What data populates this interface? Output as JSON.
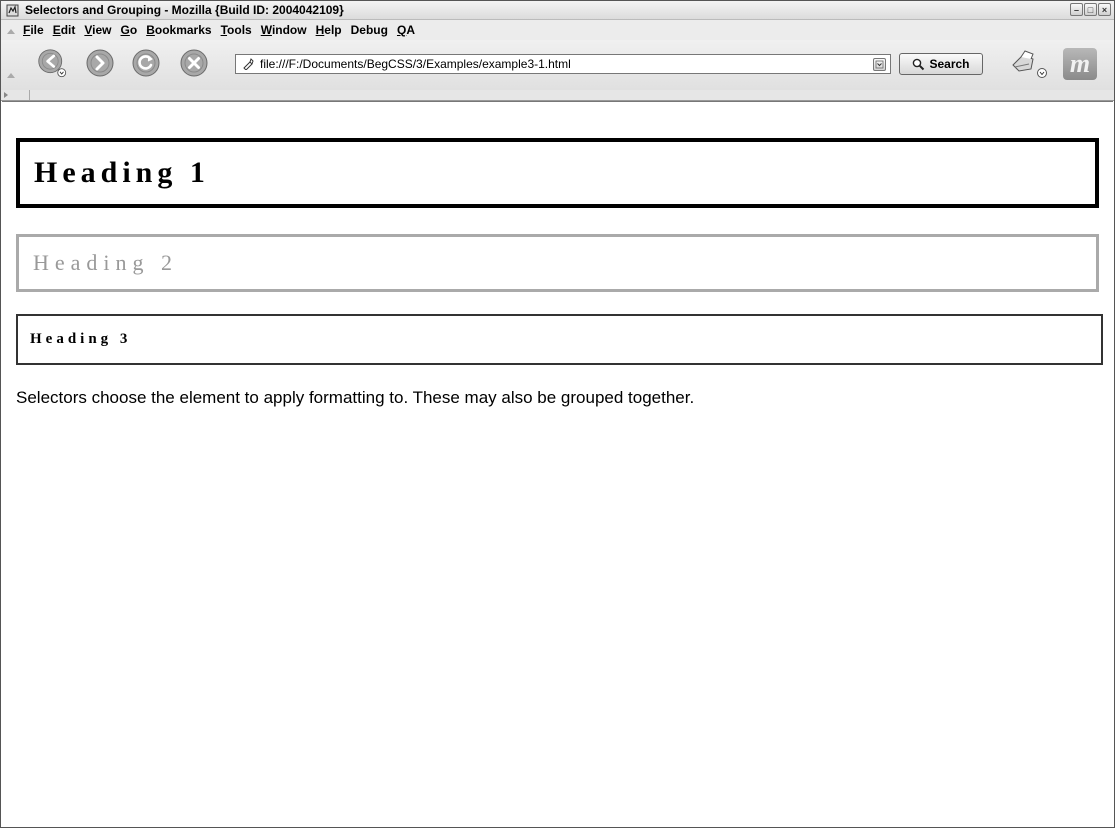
{
  "window": {
    "title": "Selectors and Grouping - Mozilla {Build ID: 2004042109}",
    "controls": [
      "minimize",
      "maximize",
      "close"
    ]
  },
  "menubar": {
    "items": [
      {
        "label": "File",
        "accel": "F"
      },
      {
        "label": "Edit",
        "accel": "E"
      },
      {
        "label": "View",
        "accel": "V"
      },
      {
        "label": "Go",
        "accel": "G"
      },
      {
        "label": "Bookmarks",
        "accel": "B"
      },
      {
        "label": "Tools",
        "accel": "T"
      },
      {
        "label": "Window",
        "accel": "W"
      },
      {
        "label": "Help",
        "accel": "H"
      },
      {
        "label": "Debug",
        "accel": "g"
      },
      {
        "label": "QA",
        "accel": "Q"
      }
    ]
  },
  "navbar": {
    "back_icon": "back-arrow-icon",
    "forward_icon": "forward-arrow-icon",
    "reload_icon": "reload-icon",
    "stop_icon": "stop-icon",
    "url": "file:///F:/Documents/BegCSS/3/Examples/example3-1.html",
    "search_label": "Search",
    "print_icon": "print-icon",
    "logo_letter": "m"
  },
  "page": {
    "heading1": "Heading 1",
    "heading2": "Heading 2",
    "heading3": "Heading 3",
    "paragraph": "Selectors choose the element to apply formatting to. These may also be grouped together."
  },
  "colors": {
    "heading1_border": "#000000",
    "heading2_border": "#aaaaaa",
    "heading2_text": "#999999",
    "heading3_border": "#333333"
  }
}
